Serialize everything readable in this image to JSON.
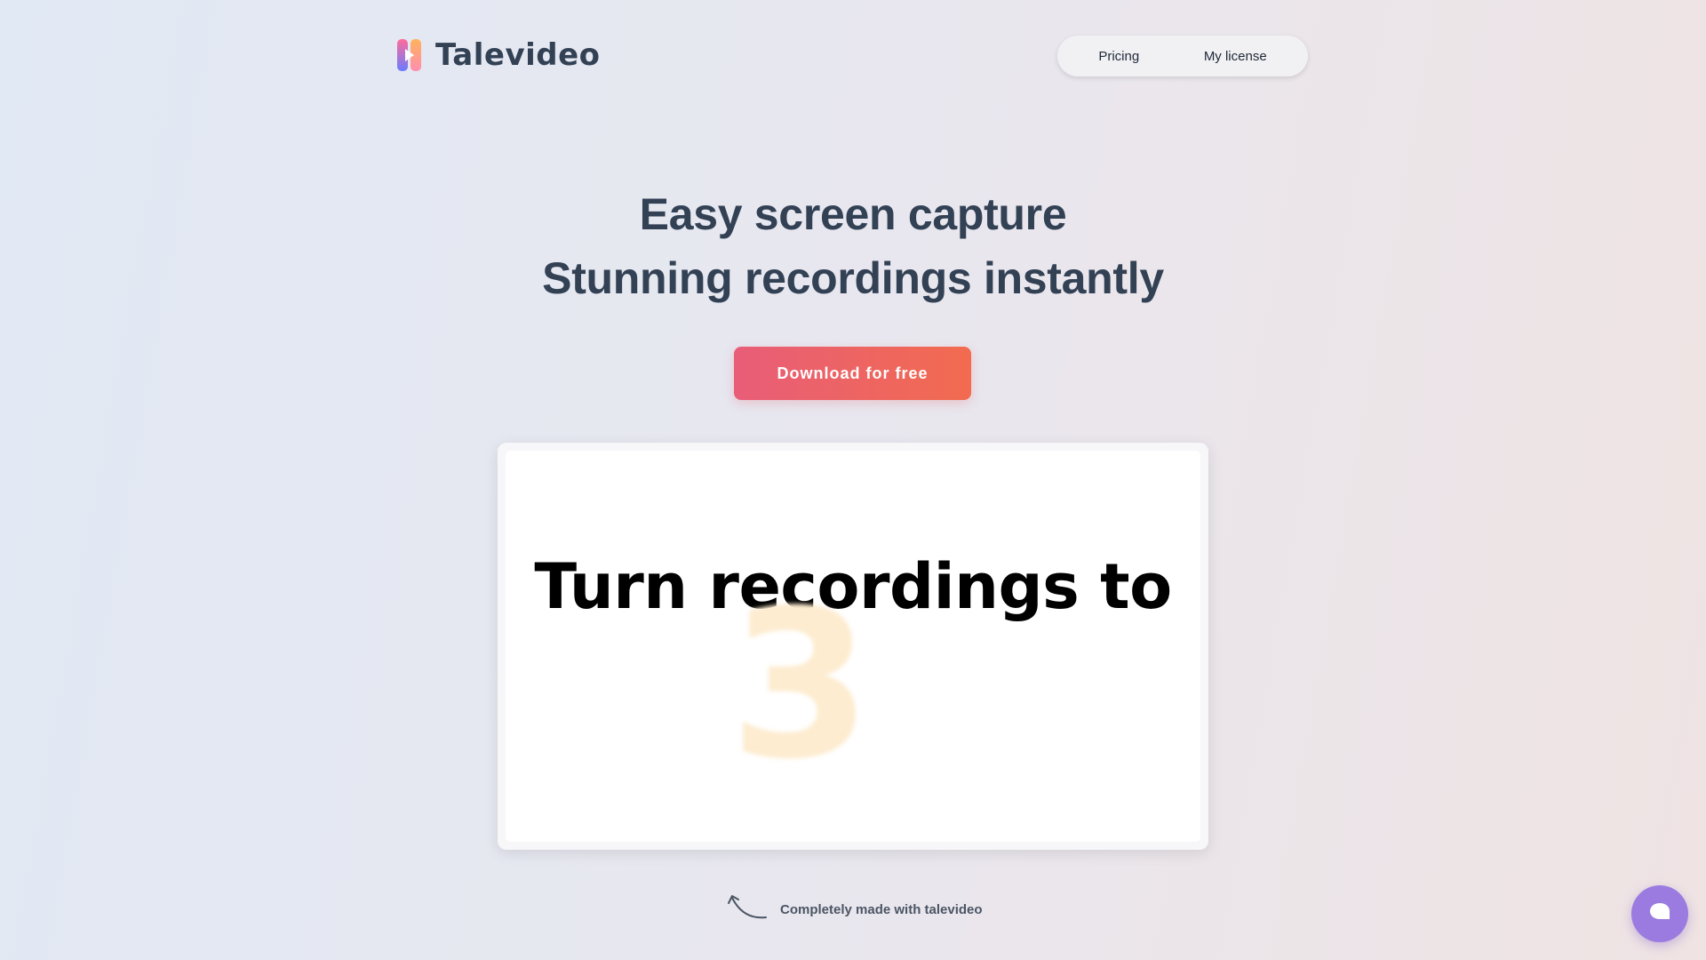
{
  "header": {
    "brand_name": "Talevideo",
    "nav": [
      {
        "label": "Pricing"
      },
      {
        "label": "My license"
      }
    ]
  },
  "hero": {
    "title_line1": "Easy screen capture",
    "title_line2": "Stunning recordings instantly",
    "cta_label": "Download for free"
  },
  "video_preview": {
    "headline": "Turn recordings to",
    "count": "3"
  },
  "caption": {
    "text": "Completely made with talevideo"
  },
  "icons": {
    "logo": "talevideo-logo-icon",
    "caption_arrow": "curved-arrow-icon",
    "chat": "chat-bubble-icon"
  },
  "colors": {
    "cta_gradient_start": "#e85d78",
    "cta_gradient_end": "#f26b4f",
    "chat_button": "#9b7be0",
    "text_dark": "#334155"
  }
}
